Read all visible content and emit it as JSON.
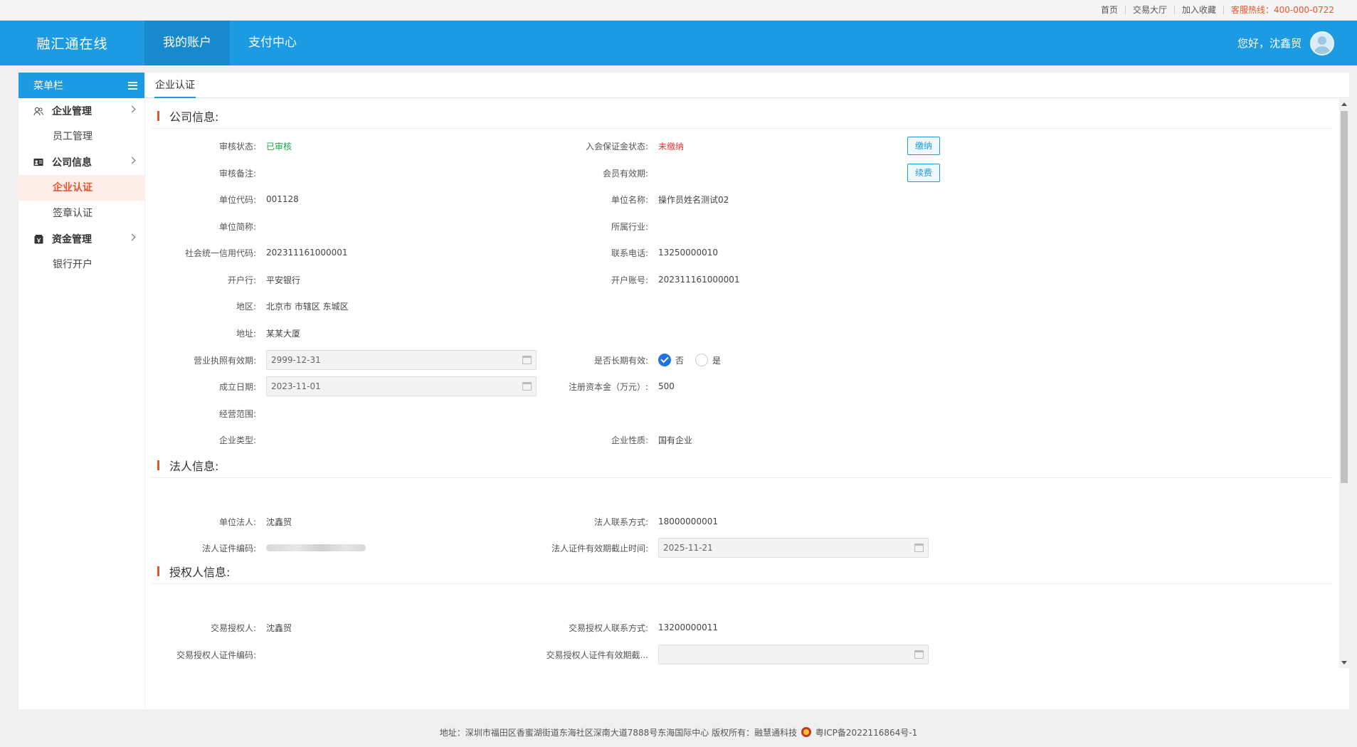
{
  "topbar": {
    "links": [
      "首页",
      "交易大厅",
      "加入收藏"
    ],
    "hotline": "客服热线：400-000-0722"
  },
  "header": {
    "brand": "融汇通在线",
    "nav": [
      "我的账户",
      "支付中心"
    ],
    "greeting": "您好，沈鑫贸"
  },
  "sidebar": {
    "title": "菜单栏",
    "groups": [
      {
        "label": "企业管理",
        "items": [
          "员工管理"
        ]
      },
      {
        "label": "公司信息",
        "items": [
          "企业认证",
          "签章认证"
        ]
      },
      {
        "label": "资金管理",
        "items": [
          "银行开户"
        ]
      }
    ]
  },
  "tab": "企业认证",
  "company": {
    "title": "公司信息:",
    "audit_status_label": "审核状态:",
    "audit_status": "已审核",
    "deposit_status_label": "入会保证金状态:",
    "deposit_status": "未缴纳",
    "pay_btn": "缴纳",
    "renew_btn": "续费",
    "audit_remark_label": "审核备注:",
    "audit_remark": "",
    "member_valid_label": "会员有效期:",
    "member_valid": "",
    "unit_code_label": "单位代码:",
    "unit_code": "001128",
    "unit_name_label": "单位名称:",
    "unit_name": "操作员姓名测试02",
    "short_name_label": "单位简称:",
    "short_name": "",
    "industry_label": "所属行业:",
    "industry": "",
    "credit_code_label": "社会统一信用代码:",
    "credit_code": "202311161000001",
    "phone_label": "联系电话:",
    "phone": "13250000010",
    "bank_label": "开户行:",
    "bank": "平安银行",
    "account_label": "开户账号:",
    "account": "202311161000001",
    "region_label": "地区:",
    "region": "北京市 市辖区 东城区",
    "address_label": "地址:",
    "address": "某某大厦",
    "license_valid_label": "营业执照有效期:",
    "license_valid": "2999-12-31",
    "long_term_label": "是否长期有效:",
    "long_term_no": "否",
    "long_term_yes": "是",
    "found_date_label": "成立日期:",
    "found_date": "2023-11-01",
    "capital_label": "注册资本金（万元）:",
    "capital": "500",
    "scope_label": "经营范围:",
    "scope": "",
    "type_label": "企业类型:",
    "type": "",
    "nature_label": "企业性质:",
    "nature": "国有企业"
  },
  "legal": {
    "title": "法人信息:",
    "person_label": "单位法人:",
    "person": "沈鑫贸",
    "phone_label": "法人联系方式:",
    "phone": "18000000001",
    "id_label": "法人证件编码:",
    "id_expire_label": "法人证件有效期截止时间:",
    "id_expire": "2025-11-21"
  },
  "authorized": {
    "title": "授权人信息:",
    "person_label": "交易授权人:",
    "person": "沈鑫贸",
    "phone_label": "交易授权人联系方式:",
    "phone": "13200000011",
    "id_label": "交易授权人证件编码:",
    "id": "",
    "id_expire_label": "交易授权人证件有效期截...",
    "id_expire": ""
  },
  "footer": {
    "text": "地址：深圳市福田区香蜜湖街道东海社区深南大道7888号东海国际中心   版权所有：融慧通科技",
    "icp": "粤ICP备2022116864号-1"
  }
}
